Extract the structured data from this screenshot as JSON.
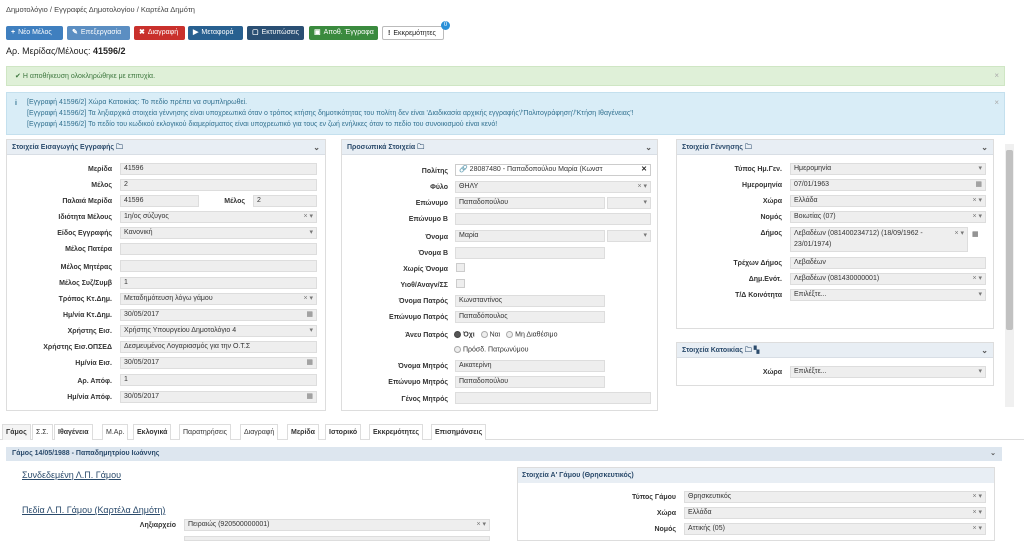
{
  "breadcrumb": "Δημοτολόγιο / Εγγραφές Δημοτολογίου / Καρτέλα Δημότη",
  "toolbar": {
    "new_member": "Νέο Μέλος",
    "edit": "Επεξεργασία",
    "delete": "Διαγραφή",
    "transfer": "Μεταφορά",
    "prints": "Εκτυπώσεις",
    "saved_docs": "Αποθ. Έγγραφα",
    "pending": "Εκκρεμότητες",
    "pending_count": "0"
  },
  "page": {
    "label": "Αρ. Μερίδας/Μέλους:",
    "value": "41596/2"
  },
  "alerts": {
    "success": "Η αποθήκευση ολοκληρώθηκε με επιτυχία.",
    "info": [
      "[Εγγραφή 41596/2] Χώρα Κατοικίας: Το πεδίο πρέπει να συμπληρωθεί.",
      "[Εγγραφή 41596/2] Τα ληξιαρχικά στοιχεία γέννησης είναι υποχρεωτικά όταν ο τρόπος κτήσης δημοτικότητας του πολίτη δεν είναι 'Διαδικασία αρχικής εγγραφής'/'Πολιτογράφηση'/'Κτήση Ιθαγένειας'!",
      "[Εγγραφή 41596/2] Το πεδίο του κωδικού εκλογικού διαμερίσματος είναι υποχρεωτικό για τους εν ζωή ενήλικες όταν το πεδίο του συνοικισμού είναι κενό!"
    ]
  },
  "panel1": {
    "title": "Στοιχεία Εισαγωγής Εγγραφής",
    "merida_label": "Μερίδα",
    "merida": "41596",
    "melos_label": "Μέλος",
    "melos": "2",
    "palaia_merida_label": "Παλαιά Μερίδα",
    "palaia_merida": "41596",
    "palaio_melos_label": "Μέλος",
    "palaio_melos": "2",
    "idiotita_label": "Ιδιότητα Μέλους",
    "idiotita": "1η/ος σύζυγος",
    "eidos_label": "Είδος Εγγραφής",
    "eidos": "Κανονική",
    "pateras_label": "Μέλος Πατέρα",
    "miteras_label": "Μέλος Μητέρας",
    "syz_label": "Μέλος Συζ/Συμβ",
    "syz": "1",
    "tropos_label": "Τρόπος Κτ.Δημ.",
    "tropos": "Μεταδημότευση λόγω γάμου",
    "hmnia_kt_label": "Ημ/νία Κτ.Δημ.",
    "hmnia_kt": "30/05/2017",
    "xristis_label": "Χρήστης Εισ.",
    "xristis": "Χρήστης Υπουργείου Δημοτολόγιο 4",
    "xristis_opsed_label": "Χρήστης Εισ.ΟΠΣΕΔ",
    "xristis_opsed": "Δεσμευμένος Λογαριασμός για την Ο.Τ.Σ",
    "hmnia_eis_label": "Ημ/νία Εισ.",
    "hmnia_eis": "30/05/2017",
    "ar_apof_label": "Αρ. Απόφ.",
    "ar_apof": "1",
    "hmnia_apof_label": "Ημ/νία Απόφ.",
    "hmnia_apof": "30/05/2017"
  },
  "panel2": {
    "title": "Προσωπικά Στοιχεία",
    "politis_label": "Πολίτης",
    "politis": "28087480 - Παπαδοπούλου Μαρία (Κωνστ",
    "fylo_label": "Φύλο",
    "fylo": "ΘΗΛΥ",
    "eponymo_label": "Επώνυμο",
    "eponymo": "Παπαδοπούλου",
    "eponymo_b_label": "Επώνυμο Β",
    "onoma_label": "Όνομα",
    "onoma": "Μαρία",
    "onoma_b_label": "Όνομα Β",
    "xoris_onoma_label": "Χωρίς Όνομα",
    "yiothes_label": "Υιοθ/Αναγν/ΣΣ",
    "onoma_patros_label": "Όνομα Πατρός",
    "onoma_patros": "Κωνσταντίνος",
    "eponymo_patros_label": "Επώνυμο Πατρός",
    "eponymo_patros": "Παπαδόπουλος",
    "aneu_patros_label": "Άνευ Πατρός",
    "opt_ochi": "Όχι",
    "opt_nai": "Ναι",
    "opt_mi": "Μη Διαθέσιμο",
    "opt_prosd": "Πρόσδ. Πατρωνύμου",
    "onoma_mitros_label": "Όνομα Μητρός",
    "onoma_mitros": "Αικατερίνη",
    "eponymo_mitros_label": "Επώνυμο Μητρός",
    "eponymo_mitros": "Παπαδοπούλου",
    "genos_mitros_label": "Γένος Μητρός"
  },
  "panel3": {
    "title": "Στοιχεία Γέννησης",
    "typos_label": "Τύπος Ημ.Γεν.",
    "typos": "Ημερομηνία",
    "hmnia_label": "Ημερομηνία",
    "hmnia": "07/01/1963",
    "xora_label": "Χώρα",
    "xora": "Ελλάδα",
    "nomos_label": "Νομός",
    "nomos": "Βοιωτίας (07)",
    "dimos_label": "Δήμος",
    "dimos_line1": "Λεβαδέων (081400234712) (18/09/1962 -",
    "dimos_line2": "23/01/1974)",
    "trexon_label": "Τρέχων Δήμος",
    "trexon": "Λεβαδέων",
    "dim_enot_label": "Δημ.Ενότ.",
    "dim_enot": "Λεβαδέων (081430000001)",
    "koinotita_label": "Τ/Δ Κοινότητα",
    "koinotita": "Επιλέξτε..."
  },
  "panel4": {
    "title": "Στοιχεία Κατοικίας",
    "xora_label": "Χώρα",
    "xora": "Επιλέξτε..."
  },
  "tabs": [
    "Γάμος",
    "Σ.Σ.",
    "Ιθαγένεια",
    "Μ.Αρ.",
    "Εκλογικά",
    "Παρατηρήσεις",
    "Διαγραφή",
    "Μερίδα",
    "Ιστορικό",
    "Εκκρεμότητες",
    "Επισημάνσεις"
  ],
  "marriage": {
    "header": "Γάμος 14/05/1988 - Παπαδημητρίου Ιωάννης",
    "linked_link": "Συνδεδεμένη Λ.Π. Γάμου",
    "fields_link": "Πεδία Λ.Π. Γάμου (Καρτέλα Δημότη)",
    "lixiarxeio_label": "Ληξιαρχείο",
    "lixiarxeio": "Πειραιώς (920500000001)",
    "a_gamou_title": "Στοιχεία Α' Γάμου (Θρησκευτικός)",
    "typos_label": "Τύπος Γάμου",
    "typos": "Θρησκευτικός",
    "xora_label": "Χώρα",
    "xora": "Ελλάδα",
    "nomos_label": "Νομός",
    "nomos": "Αττικής (05)"
  }
}
